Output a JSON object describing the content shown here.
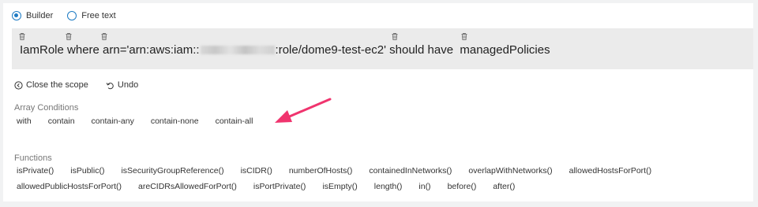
{
  "mode": {
    "options": [
      {
        "label": "Builder",
        "selected": true
      },
      {
        "label": "Free text",
        "selected": false
      }
    ]
  },
  "query": {
    "part1": "IamRole where arn='arn:aws:iam::",
    "part2": ":role/dome9-test-ec2' should have  managedPolicies"
  },
  "actions": {
    "close_scope": "Close the scope",
    "undo": "Undo"
  },
  "array_conditions": {
    "label": "Array Conditions",
    "items": [
      "with",
      "contain",
      "contain-any",
      "contain-none",
      "contain-all"
    ]
  },
  "functions": {
    "label": "Functions",
    "row1": [
      "isPrivate()",
      "isPublic()",
      "isSecurityGroupReference()",
      "isCIDR()",
      "numberOfHosts()",
      "containedInNetworks()",
      "overlapWithNetworks()",
      "allowedHostsForPort()"
    ],
    "row2": [
      "allowedPublicHostsForPort()",
      "areCIDRsAllowedForPort()",
      "isPortPrivate()",
      "isEmpty()",
      "length()",
      "in()",
      "before()",
      "after()"
    ]
  },
  "colors": {
    "radio_accent": "#1d7bc4",
    "annotation_arrow": "#f0346e"
  }
}
